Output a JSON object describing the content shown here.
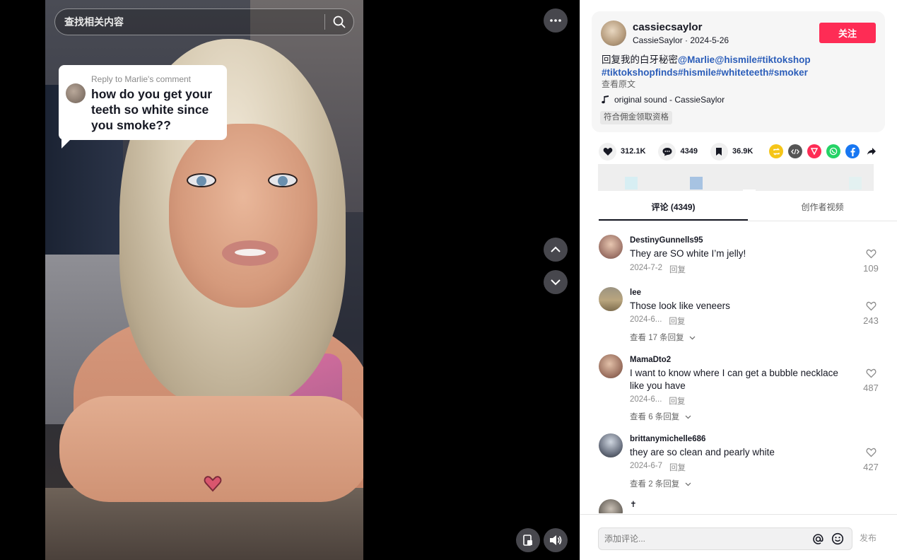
{
  "search": {
    "placeholder": "查找相关内容"
  },
  "overlay": {
    "reply_label": "Reply to Marlie's comment",
    "reply_text": "how do you get your teeth so white since you smoke??"
  },
  "author": {
    "username": "cassiecsaylor",
    "display_name": "CassieSaylor",
    "date": "2024-5-26",
    "follow_label": "关注"
  },
  "caption": {
    "text": "回复我的白牙秘密",
    "tags": [
      "@Marlie",
      "@hismile",
      "#tiktokshop",
      "#tiktokshopfinds",
      "#hismile",
      "#whiteteeth",
      "#smoker"
    ],
    "view_original": "查看原文",
    "sound": "original sound - CassieSaylor",
    "commission": "符合佣金领取资格"
  },
  "stats": {
    "likes": "312.1K",
    "comments": "4349",
    "saves": "36.9K"
  },
  "share_icons": [
    "repost-icon",
    "embed-icon",
    "send-icon",
    "whatsapp-icon",
    "facebook-icon",
    "share-arrow-icon"
  ],
  "colors": {
    "follow": "#fe2c55",
    "hashtag": "#2b5db9",
    "repost": "#f5c518",
    "embed": "#555555",
    "send": "#fe2c55",
    "whatsapp": "#25d366",
    "facebook": "#1877f2"
  },
  "tabs": [
    {
      "label": "评论 (4349)",
      "active": true
    },
    {
      "label": "创作者视频",
      "active": false
    }
  ],
  "comments": [
    {
      "user": "DestinyGunnells95",
      "text": "They are SO white I’m jelly!",
      "date": "2024-7-2",
      "reply": "回复",
      "likes": "109",
      "more": ""
    },
    {
      "user": "lee",
      "text": "Those look like veneers",
      "date": "2024-6...",
      "reply": "回复",
      "likes": "243",
      "more": "查看 17 条回复"
    },
    {
      "user": "MamaDto2",
      "text": "I want to know where I can get a bubble necklace like you have",
      "date": "2024-6...",
      "reply": "回复",
      "likes": "487",
      "more": "查看 6 条回复"
    },
    {
      "user": "brittanymichelle686",
      "text": "they are so clean and pearly white",
      "date": "2024-6-7",
      "reply": "回复",
      "likes": "427",
      "more": "查看 2 条回复"
    },
    {
      "user": "✝",
      "text": "",
      "date": "",
      "reply": "",
      "likes": "",
      "more": ""
    }
  ],
  "comment_box": {
    "placeholder": "添加评论...",
    "post_label": "发布"
  }
}
